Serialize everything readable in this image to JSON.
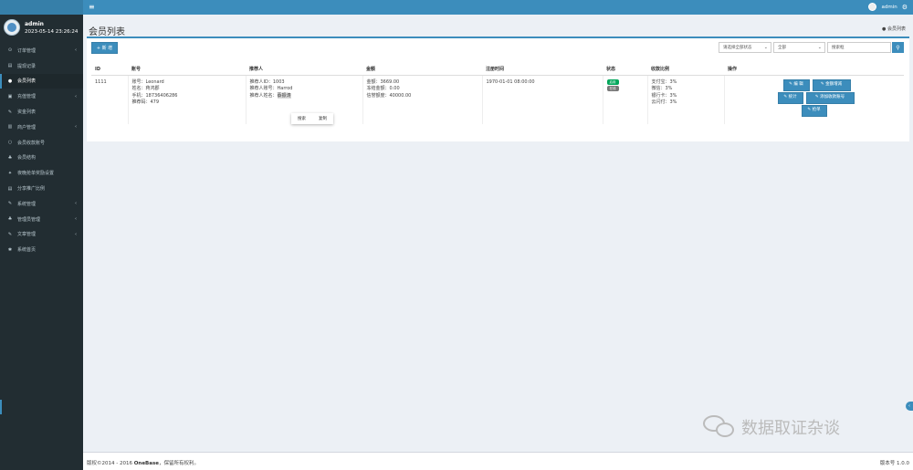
{
  "user": {
    "name": "admin",
    "time": "2023-05-14 23:26:24"
  },
  "menu": [
    {
      "label": "订单管理",
      "icon": "⊙",
      "arrow": "‹"
    },
    {
      "label": "提现记录",
      "icon": "▤",
      "arrow": ""
    },
    {
      "label": "会员列表",
      "icon": "●",
      "arrow": ""
    },
    {
      "label": "充值管理",
      "icon": "▣",
      "arrow": "‹"
    },
    {
      "label": "资金列表",
      "icon": "✎",
      "arrow": ""
    },
    {
      "label": "商户管理",
      "icon": "▥",
      "arrow": "‹"
    },
    {
      "label": "会员收款账号",
      "icon": "○",
      "arrow": ""
    },
    {
      "label": "会员结构",
      "icon": "♣",
      "arrow": ""
    },
    {
      "label": "夜晚抢单奖励设置",
      "icon": "✦",
      "arrow": ""
    },
    {
      "label": "分享推广比例",
      "icon": "▤",
      "arrow": ""
    },
    {
      "label": "系统管理",
      "icon": "✎",
      "arrow": "‹"
    },
    {
      "label": "管理员管理",
      "icon": "♣",
      "arrow": "‹"
    },
    {
      "label": "文章管理",
      "icon": "✎",
      "arrow": "‹"
    },
    {
      "label": "系统首页",
      "icon": "✱",
      "arrow": ""
    }
  ],
  "header": {
    "username": "admin"
  },
  "page": {
    "title": "会员列表",
    "breadcrumb": "会员列表"
  },
  "toolbar": {
    "add_label": "+ 新 增",
    "filter_status": "请选择全部状态",
    "filter_all": "全部",
    "search_placeholder": "搜索框"
  },
  "table": {
    "headers": [
      "ID",
      "账号",
      "推荐人",
      "金额",
      "注册时间",
      "状态",
      "收款比例",
      "操作"
    ],
    "row": {
      "id": "1111",
      "account": [
        "账号：Leonard",
        "姓名：蒋鸿郡",
        "手机：18736406286",
        "推荐码：479"
      ],
      "referrer": [
        "推荐人ID：1003",
        "推荐人账号：Harrod",
        "推荐人姓名："
      ],
      "referrer_name": "蔡振涛",
      "amount": [
        "金额：3669.00",
        "冻结金额：0.00",
        "信誉额度：40000.00"
      ],
      "reg_time": "1970-01-01 08:00:00",
      "status": [
        "启用",
        "在线"
      ],
      "ratio": [
        "支付宝：3%",
        "微信：3%",
        "银行卡：3%",
        "云闪付：3%"
      ],
      "ops": {
        "edit": "编 辑",
        "fund": "金额增减",
        "stats": "统计",
        "add_account": "添加收款账号",
        "grab": "抢单"
      }
    }
  },
  "context_menu": {
    "search": "搜索",
    "copy": "复制"
  },
  "footer": {
    "copyright": "版权©2014 - 2016 ",
    "brand": "OneBase",
    "rights": "，保留所有权利。",
    "version": "版本号 1.0.0"
  },
  "watermark": "数据取证杂谈"
}
